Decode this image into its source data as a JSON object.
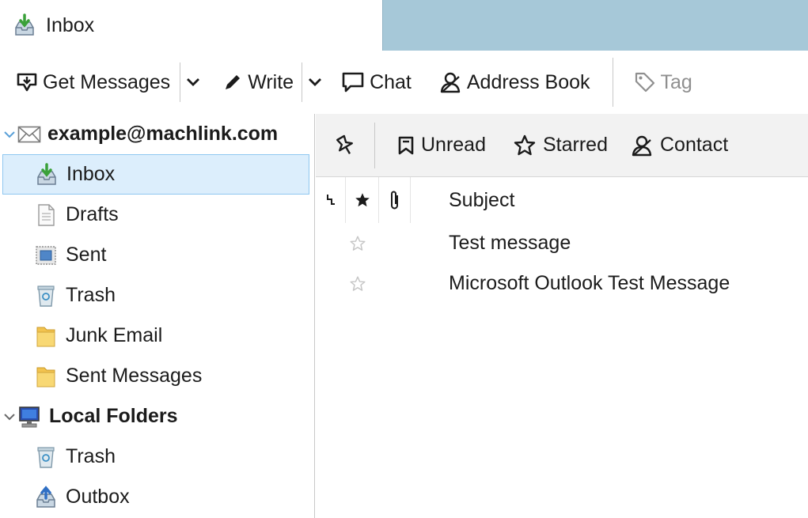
{
  "tab": {
    "title": "Inbox"
  },
  "toolbar": {
    "get_messages": "Get Messages",
    "write": "Write",
    "chat": "Chat",
    "address_book": "Address Book",
    "tag": "Tag"
  },
  "folders": {
    "account": "example@machlink.com",
    "account_items": [
      {
        "label": "Inbox",
        "icon": "inbox-icon",
        "selected": true
      },
      {
        "label": "Drafts",
        "icon": "drafts-icon"
      },
      {
        "label": "Sent",
        "icon": "sent-icon"
      },
      {
        "label": "Trash",
        "icon": "trash-icon"
      },
      {
        "label": "Junk Email",
        "icon": "folder-icon"
      },
      {
        "label": "Sent Messages",
        "icon": "folder-icon"
      }
    ],
    "local": "Local Folders",
    "local_items": [
      {
        "label": "Trash",
        "icon": "trash-icon"
      },
      {
        "label": "Outbox",
        "icon": "outbox-icon"
      }
    ]
  },
  "quick_filter": {
    "unread": "Unread",
    "starred": "Starred",
    "contact": "Contact"
  },
  "thread_pane": {
    "subject_header": "Subject",
    "messages": [
      {
        "subject": "Test message",
        "starred": false
      },
      {
        "subject": "Microsoft Outlook Test Message",
        "starred": false
      }
    ]
  },
  "colors": {
    "tab_spacer": "#a6c8d8",
    "selected_row_bg": "#dceefc",
    "selected_row_border": "#8fc7f0",
    "filter_bar_bg": "#f2f2f2"
  }
}
